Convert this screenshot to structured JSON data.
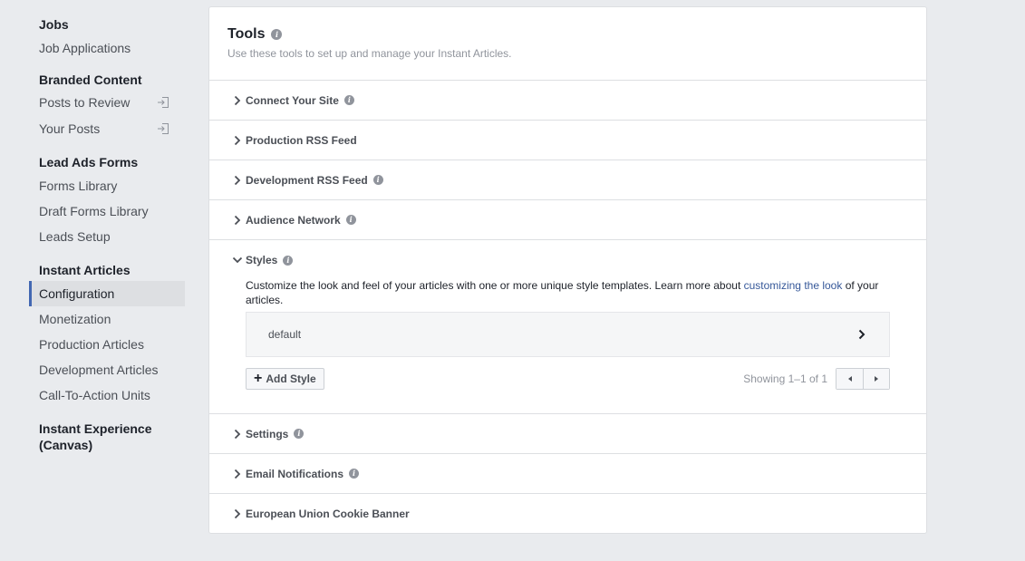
{
  "sidebar": {
    "sections": [
      {
        "title": "Jobs",
        "items": [
          {
            "label": "Job Applications"
          }
        ]
      },
      {
        "title": "Branded Content",
        "items": [
          {
            "label": "Posts to Review"
          },
          {
            "label": "Your Posts"
          }
        ]
      },
      {
        "title": "Lead Ads Forms",
        "items": [
          {
            "label": "Forms Library"
          },
          {
            "label": "Draft Forms Library"
          },
          {
            "label": "Leads Setup"
          }
        ]
      },
      {
        "title": "Instant Articles",
        "items": [
          {
            "label": "Configuration"
          },
          {
            "label": "Monetization"
          },
          {
            "label": "Production Articles"
          },
          {
            "label": "Development Articles"
          },
          {
            "label": "Call-To-Action Units"
          }
        ]
      },
      {
        "title": "Instant Experience",
        "title_line2": "(Canvas)"
      }
    ]
  },
  "tools": {
    "title": "Tools",
    "subtitle": "Use these tools to set up and manage your Instant Articles.",
    "rows": [
      {
        "label": "Connect Your Site"
      },
      {
        "label": "Production RSS Feed"
      },
      {
        "label": "Development RSS Feed"
      },
      {
        "label": "Audience Network"
      }
    ],
    "styles": {
      "label": "Styles",
      "desc_before": "Customize the look and feel of your articles with one or more unique style templates. Learn more about ",
      "desc_link": "customizing the look",
      "desc_after": " of your articles.",
      "item": "default",
      "add_button": "Add Style",
      "showing": "Showing 1–1 of 1"
    },
    "rows_after": [
      {
        "label": "Settings"
      },
      {
        "label": "Email Notifications"
      },
      {
        "label": "European Union Cookie Banner"
      }
    ]
  },
  "colors": {
    "accent": "#4267b2",
    "link": "#365899",
    "background": "#e9ebee"
  }
}
